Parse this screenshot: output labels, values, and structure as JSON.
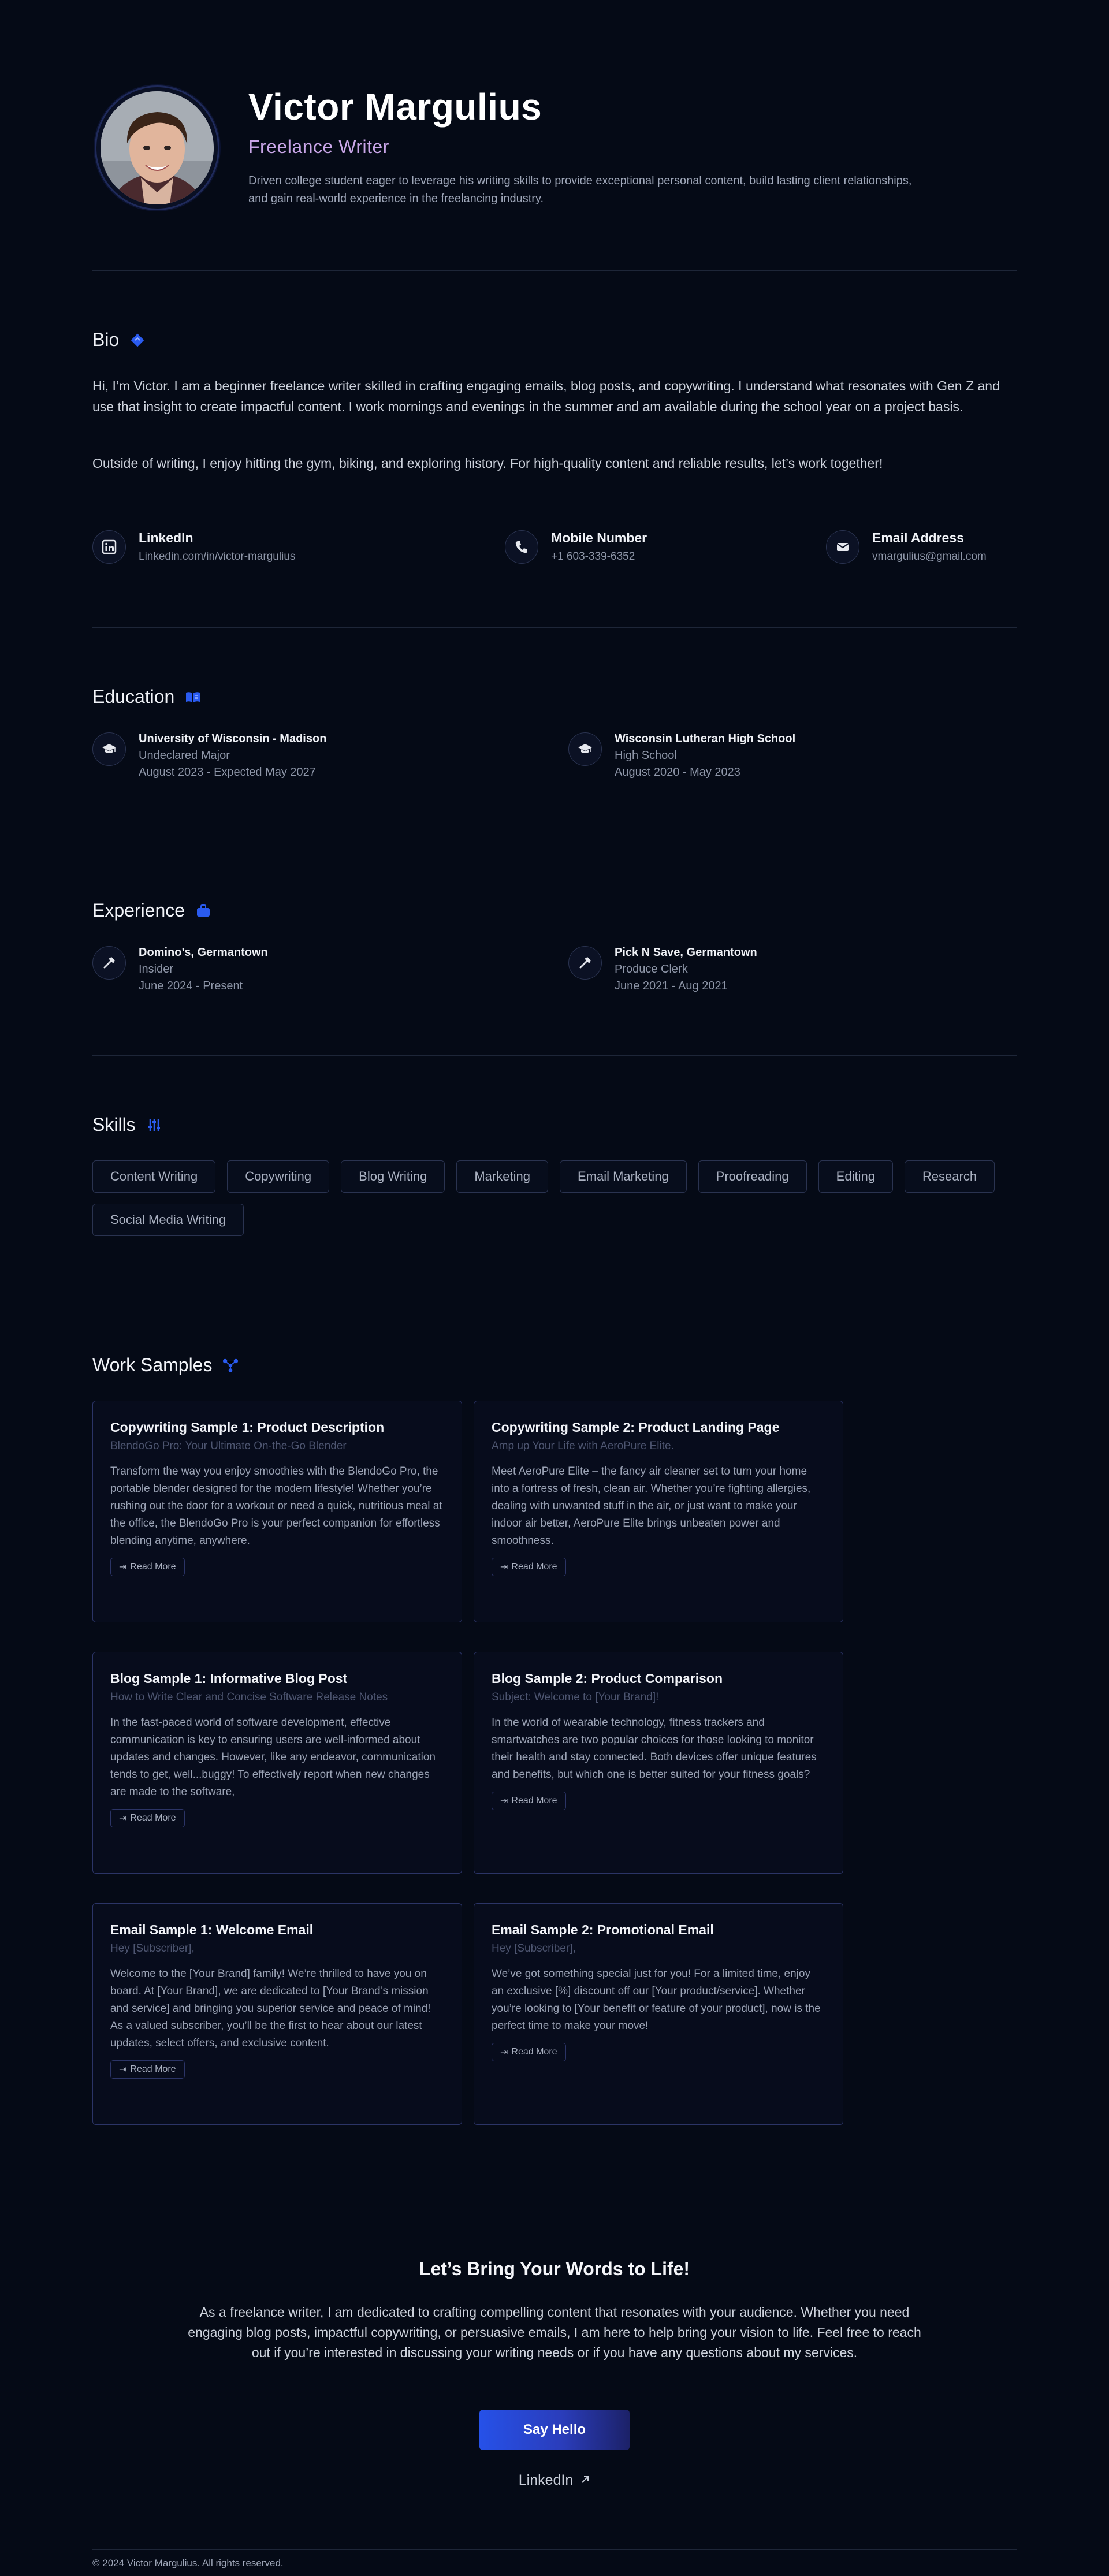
{
  "profile": {
    "name": "Victor Margulius",
    "title": "Freelance Writer",
    "description": "Driven college student eager to leverage his writing skills to provide exceptional personal content, build lasting client relationships, and gain real-world experience in the freelancing industry."
  },
  "bio": {
    "heading": "Bio",
    "paragraphs": [
      "Hi, I’m Victor. I am a beginner freelance writer skilled in crafting engaging emails, blog posts, and copywriting. I understand what resonates with Gen Z and use that insight to create impactful content. I work mornings and evenings in the summer and am available during the school year on a project basis.",
      "Outside of writing, I enjoy hitting the gym, biking, and exploring history. For high-quality content and reliable results, let’s work together!"
    ],
    "contacts": [
      {
        "label": "LinkedIn",
        "value": "Linkedin.com/in/victor-margulius",
        "icon": "linkedin-icon"
      },
      {
        "label": "Mobile Number",
        "value": "+1 603-339-6352",
        "icon": "phone-icon"
      },
      {
        "label": "Email Address",
        "value": "vmargulius@gmail.com",
        "icon": "envelope-icon"
      }
    ]
  },
  "education": {
    "heading": "Education",
    "items": [
      {
        "name": "University of Wisconsin - Madison",
        "detail": "Undeclared Major",
        "dates": "August 2023 - Expected May 2027"
      },
      {
        "name": "Wisconsin Lutheran High School",
        "detail": "High School",
        "dates": "August 2020 - May 2023"
      }
    ]
  },
  "experience": {
    "heading": "Experience",
    "items": [
      {
        "name": "Domino’s, Germantown",
        "detail": "Insider",
        "dates": "June 2024 - Present"
      },
      {
        "name": "Pick N Save, Germantown",
        "detail": "Produce Clerk",
        "dates": "June 2021 - Aug 2021"
      }
    ]
  },
  "skills": {
    "heading": "Skills",
    "items": [
      "Content Writing",
      "Copywriting",
      "Blog Writing",
      "Marketing",
      "Email Marketing",
      "Proofreading",
      "Editing",
      "Research",
      "Social Media Writing"
    ]
  },
  "work": {
    "heading": "Work Samples",
    "read_more": "Read More",
    "cards": [
      {
        "title": "Copywriting Sample 1: Product Description",
        "subtitle": "BlendoGo Pro: Your Ultimate On-the-Go Blender",
        "body": "Transform the way you enjoy smoothies with the BlendoGo Pro, the portable blender designed for the modern lifestyle! Whether you’re rushing out the door for a workout or need a quick, nutritious meal at the office, the BlendoGo Pro is your perfect companion for effortless blending anytime, anywhere."
      },
      {
        "title": "Copywriting Sample 2: Product Landing Page",
        "subtitle": "Amp up Your Life with AeroPure Elite.",
        "body": "Meet AeroPure Elite – the fancy air cleaner set to turn your home into a fortress of fresh, clean air. Whether you’re fighting allergies, dealing with unwanted stuff in the air, or just want to make your indoor air better, AeroPure Elite brings unbeaten power and smoothness."
      },
      {
        "title": "Blog Sample 1: Informative Blog Post",
        "subtitle": "How to Write Clear and Concise Software Release Notes",
        "body": "In the fast-paced world of software development, effective communication is key to ensuring users are well-informed about updates and changes. However, like any endeavor, communication tends to get, well...buggy! To effectively report when new changes are made to the software,"
      },
      {
        "title": "Blog Sample 2: Product Comparison",
        "subtitle": "Subject: Welcome to [Your Brand]!",
        "body": "In the world of wearable technology, fitness trackers and smartwatches are two popular choices for those looking to monitor their health and stay connected. Both devices offer unique features and benefits, but which one is better suited for your fitness goals?"
      },
      {
        "title": "Email Sample 1: Welcome Email",
        "subtitle": "Hey [Subscriber],",
        "body": "Welcome to the [Your Brand] family! We’re thrilled to have you on board. At [Your Brand], we are dedicated to [Your Brand’s mission and service] and bringing you superior service and peace of mind! As a valued subscriber, you’ll be the first to hear about our latest updates, select offers, and exclusive content."
      },
      {
        "title": "Email Sample 2: Promotional Email",
        "subtitle": "Hey [Subscriber],",
        "body": "We’ve got something special just for you! For a limited time, enjoy an exclusive [%] discount off our [Your product/service]. Whether you’re looking to [Your benefit or feature of your product], now is the perfect time to make your move!"
      }
    ]
  },
  "cta": {
    "title": "Let’s Bring Your Words to Life!",
    "text": "As a freelance writer, I am dedicated to crafting compelling content that resonates with your audience. Whether you need engaging blog posts, impactful copywriting, or persuasive emails, I am here to help bring your vision to life. Feel free to reach out if you’re interested in discussing your writing needs or if you have any questions about my services.",
    "button": "Say Hello",
    "link": "LinkedIn"
  },
  "footer": {
    "text": "© 2024 Victor Margulius. All rights reserved."
  },
  "colors": {
    "background": "#050a16",
    "accent": "#2651e8",
    "title_accent": "#c9a6e8"
  }
}
